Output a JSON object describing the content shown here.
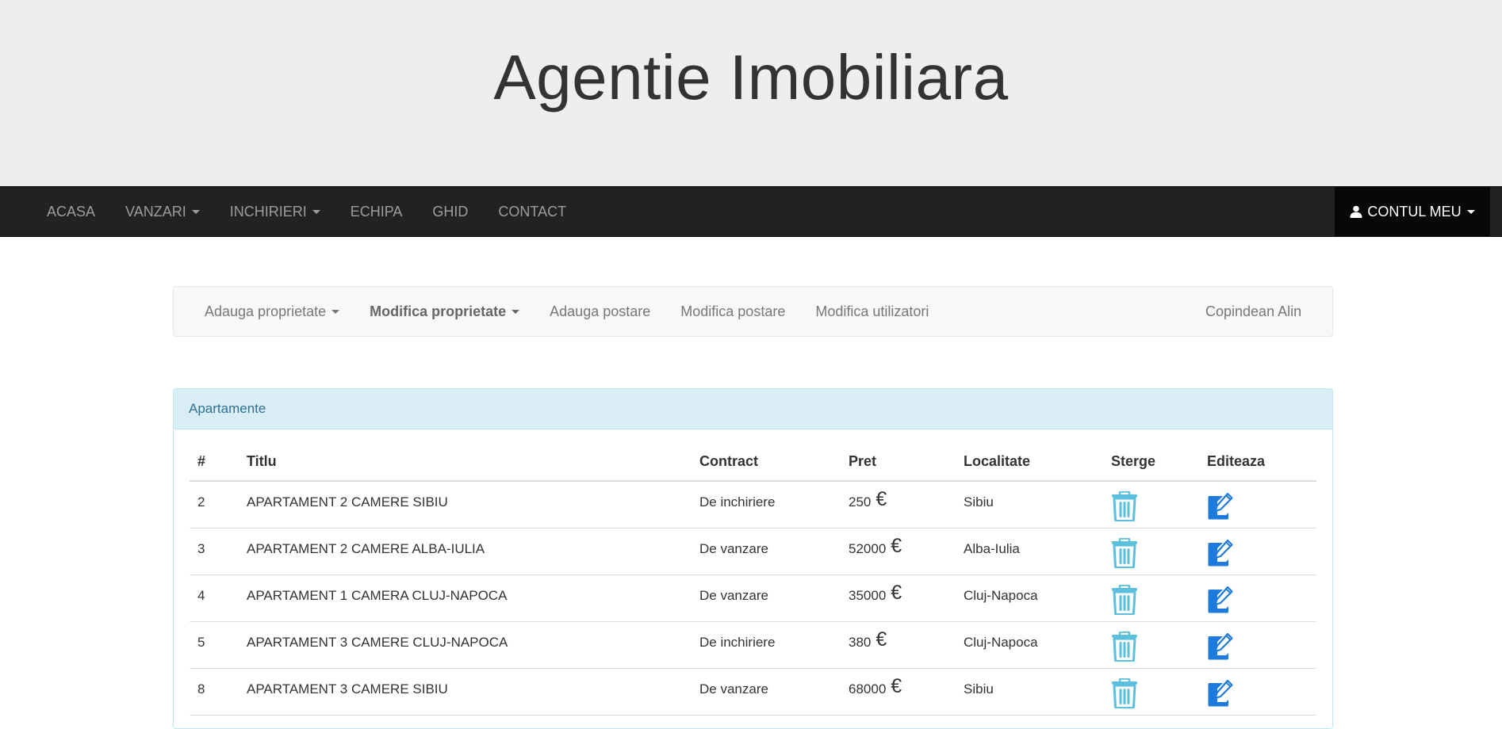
{
  "site": {
    "title": "Agentie Imobiliara"
  },
  "navbar": {
    "items": [
      {
        "label": "ACASA",
        "dropdown": false
      },
      {
        "label": "VANZARI",
        "dropdown": true
      },
      {
        "label": "INCHIRIERI",
        "dropdown": true
      },
      {
        "label": "ECHIPA",
        "dropdown": false
      },
      {
        "label": "GHID",
        "dropdown": false
      },
      {
        "label": "CONTACT",
        "dropdown": false
      }
    ],
    "account_label": "CONTUL MEU",
    "account_icon": "user-icon"
  },
  "subnav": {
    "items": [
      {
        "label": "Adauga proprietate",
        "dropdown": true,
        "active": false
      },
      {
        "label": "Modifica proprietate",
        "dropdown": true,
        "active": true
      },
      {
        "label": "Adauga postare",
        "dropdown": false,
        "active": false
      },
      {
        "label": "Modifica postare",
        "dropdown": false,
        "active": false
      },
      {
        "label": "Modifica utilizatori",
        "dropdown": false,
        "active": false
      }
    ],
    "user_name": "Copindean Alin"
  },
  "panel": {
    "heading": "Apartamente",
    "columns": [
      "#",
      "Titlu",
      "Contract",
      "Pret",
      "Localitate",
      "Sterge",
      "Editeaza"
    ],
    "currency_symbol": "€",
    "rows": [
      {
        "id": "2",
        "title": "APARTAMENT 2 CAMERE SIBIU",
        "contract": "De inchiriere",
        "price": "250",
        "location": "Sibiu"
      },
      {
        "id": "3",
        "title": "APARTAMENT 2 CAMERE ALBA-IULIA",
        "contract": "De vanzare",
        "price": "52000",
        "location": "Alba-Iulia"
      },
      {
        "id": "4",
        "title": "APARTAMENT 1 CAMERA CLUJ-NAPOCA",
        "contract": "De vanzare",
        "price": "35000",
        "location": "Cluj-Napoca"
      },
      {
        "id": "5",
        "title": "APARTAMENT 3 CAMERE CLUJ-NAPOCA",
        "contract": "De inchiriere",
        "price": "380",
        "location": "Cluj-Napoca"
      },
      {
        "id": "8",
        "title": "APARTAMENT 3 CAMERE SIBIU",
        "contract": "De vanzare",
        "price": "68000",
        "location": "Sibiu"
      }
    ],
    "delete_icon": "trash-icon",
    "edit_icon": "edit-icon"
  },
  "colors": {
    "jumbotron_bg": "#eeeeee",
    "navbar_bg": "#222222",
    "panel_heading_bg": "#d9edf7",
    "trash_icon": "#5bc0de",
    "edit_icon": "#1e7bdb"
  }
}
